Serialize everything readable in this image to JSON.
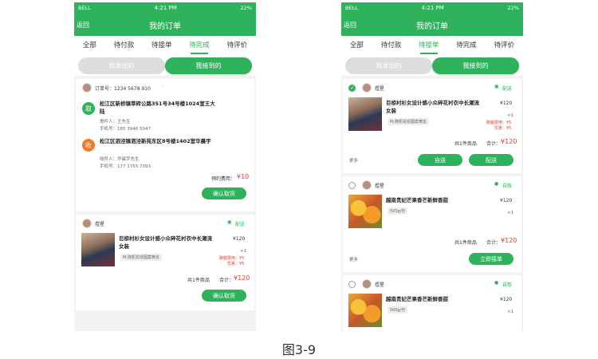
{
  "status": {
    "carrier": "BELL",
    "time": "4:21 PM",
    "battery": "22%"
  },
  "nav": {
    "back": "返回",
    "title": "我的订单"
  },
  "left": {
    "tabs": [
      "全部",
      "待付款",
      "待接单",
      "待完成",
      "待评价"
    ],
    "active_tab": "待完成",
    "seg": [
      "我发出的",
      "我接到的"
    ],
    "order": {
      "order_no": "订单号：1234 5678 910",
      "pick_icon": "取",
      "pick_addr": "松江区新桥镇莘砖公路351号34号楼1024室王大陆",
      "pick_sender": "寄件人：王先生",
      "pick_phone": "手机号：185 3946 5047",
      "recv_icon": "收",
      "recv_addr": "松江区泗泾镇泗泾新苑东区8号楼1402室华晨宇",
      "recv_name": "收件人：华晨宇先生",
      "recv_phone": "手机号：177 1755 7393",
      "fee_label": "预约费用：",
      "fee": "¥10",
      "btn": "确认取货"
    },
    "goods": {
      "shop": "煜星",
      "delivery": "配送",
      "title": "巨椋村衫女设计感小众碎花衬衣中长潮流女装",
      "spec": "M;随机花纹图案黄友",
      "price": "¥120",
      "qty": "×1",
      "extra_fee": "跑腿费用：¥5",
      "discount": "优惠：¥5",
      "total_count": "共1件商品",
      "total_label": "合计：",
      "total": "¥120",
      "btn": "确认取货"
    }
  },
  "right": {
    "tabs": [
      "全部",
      "待付款",
      "待接单",
      "待完成",
      "待评价"
    ],
    "active_tab": "待接单",
    "seg": [
      "我发出的",
      "我接到的"
    ],
    "card1": {
      "shop": "煜星",
      "delivery": "配送",
      "title": "巨椋村衫女设计感小众碎花衬衣中长潮流女装",
      "spec": "M;随机花纹图案黄友",
      "price": "¥120",
      "qty": "×1",
      "extra_fee": "跑腿费用：¥5",
      "discount": "优惠：¥5",
      "total_count": "共1件商品",
      "total_label": "合计：",
      "total": "¥120",
      "more": "更多",
      "btn1": "自送",
      "btn2": "配送"
    },
    "card2": {
      "shop": "煜星",
      "delivery": "自取",
      "title": "越南贵妃芒果香芒新鲜香甜",
      "spec": "500g/份",
      "price": "¥120",
      "qty": "×1",
      "total_count": "共1件商品",
      "total_label": "合计：",
      "total": "¥120",
      "more": "更多",
      "btn": "立即接单"
    },
    "card3": {
      "shop": "煜星",
      "delivery": "自取",
      "title": "越南贵妃芒果香芒新鲜香甜",
      "spec": "500g/份",
      "price": "¥120",
      "qty": "×1"
    }
  },
  "caption": "图3-9",
  "colors": {
    "accent": "#2fb25c",
    "price": "#e8392e",
    "orange": "#f07a2a"
  }
}
